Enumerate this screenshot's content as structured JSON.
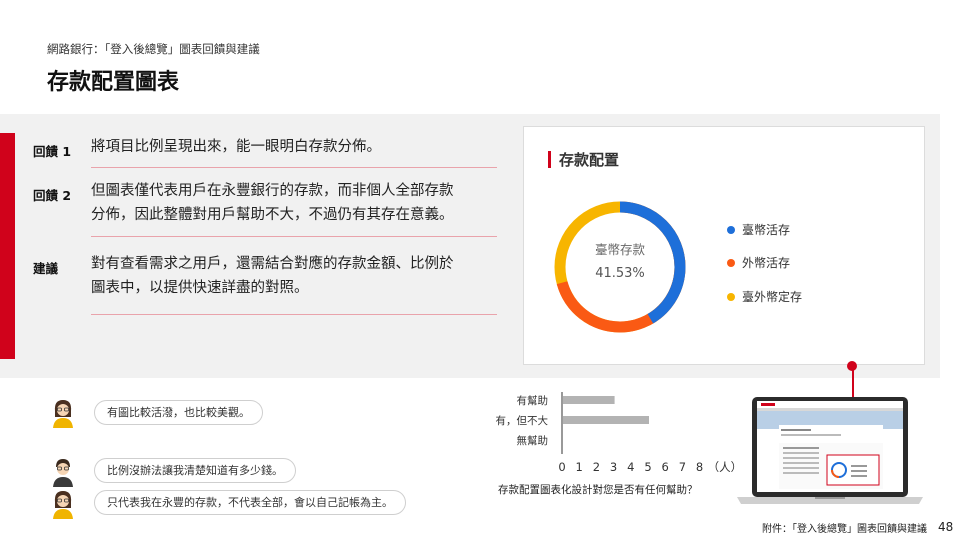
{
  "header": {
    "breadcrumb": "網路銀行：「登入後總覽」圖表回饋與建議",
    "title": "存款配置圖表"
  },
  "accent_color": "#d0021b",
  "feedback": [
    {
      "label": "回饋 1",
      "lines": [
        "將項目比例呈現出來，能一眼明白存款分佈。"
      ]
    },
    {
      "label": "回饋 2",
      "lines": [
        "但圖表僅代表用戶在永豐銀行的存款，而非個人全部存款",
        "分佈，因此整體對用戶幫助不大，不過仍有其存在意義。"
      ]
    },
    {
      "label": "建議",
      "lines": [
        "對有查看需求之用戶，還需結合對應的存款金額、比例於",
        "圖表中，以提供快速詳盡的對照。"
      ]
    }
  ],
  "deposit_card": {
    "title": "存款配置",
    "center_label": "臺幣存款",
    "center_value": "41.53%",
    "legend": [
      {
        "label": "臺幣活存",
        "color": "#1e6fd9"
      },
      {
        "label": "外幣活存",
        "color": "#fa5a14"
      },
      {
        "label": "臺外幣定存",
        "color": "#f7b500"
      }
    ]
  },
  "comments": [
    {
      "text": "有圖比較活潑，也比較美觀。",
      "avatar": "female-avatar-icon"
    },
    {
      "text": "比例沒辦法讓我清楚知道有多少錢。",
      "avatar": "male-avatar-icon"
    },
    {
      "text": "只代表我在永豐的存款，不代表全部，會以自己記帳為主。",
      "avatar": "female-avatar-icon"
    }
  ],
  "chart_data": {
    "type": "bar",
    "orientation": "horizontal",
    "categories": [
      "有幫助",
      "有，但不大",
      "無幫助"
    ],
    "values": [
      3,
      5,
      0
    ],
    "xlim": [
      0,
      8
    ],
    "xticks": [
      "0",
      "1",
      "2",
      "3",
      "4",
      "5",
      "6",
      "7",
      "8"
    ],
    "xunit": "（人）",
    "caption": "存款配置圖表化設計對您是否有任何幫助？",
    "bar_color": "#b3b3b3"
  },
  "footer": {
    "text": "附件：「登入後總覽」圖表回饋與建議",
    "page_number": "48"
  }
}
